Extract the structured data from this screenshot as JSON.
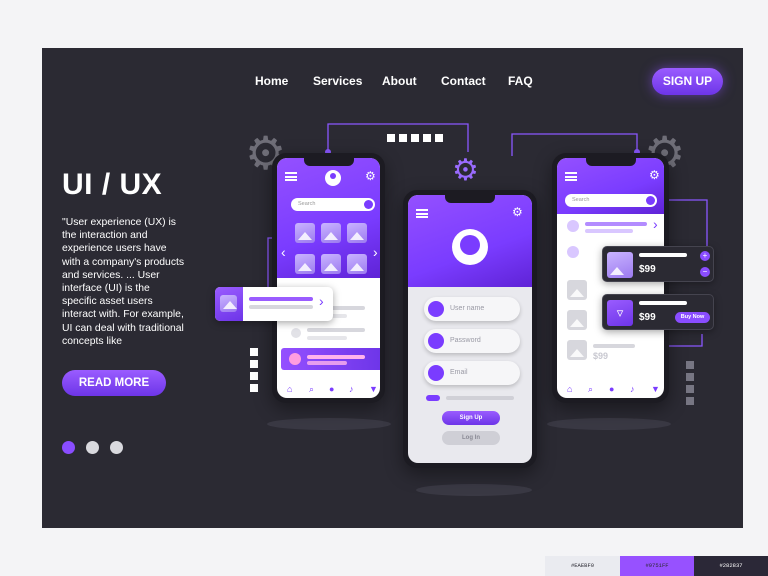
{
  "colors": {
    "lavender": "#EAEBF0",
    "purple": "#9751FF",
    "dark": "#2B2837"
  },
  "nav": {
    "links": [
      "Home",
      "Services",
      "About",
      "Contact",
      "FAQ"
    ],
    "signup": "SIGN UP"
  },
  "hero": {
    "title": "UI / UX",
    "description": "\"User experience (UX) is the interaction and experience users have with a company's products and services. ... User interface (UI) is the specific asset users interact with. For example, UI can deal with traditional concepts like",
    "cta": "READ MORE",
    "pagination": {
      "count": 3,
      "active": 1
    }
  },
  "phone_left": {
    "search_placeholder": "Search"
  },
  "phone_center": {
    "username_placeholder": "User name",
    "password_placeholder": "Password",
    "email_placeholder": "Email",
    "signup_button": "Sign Up",
    "login_button": "Log In"
  },
  "phone_right": {
    "search_placeholder": "Search",
    "price_1": "$99",
    "price_2": "$99",
    "price_3": "$99",
    "buy_now": "Buy Now"
  },
  "swatches": [
    "#EAEBF0",
    "#9751FF",
    "#282837"
  ]
}
